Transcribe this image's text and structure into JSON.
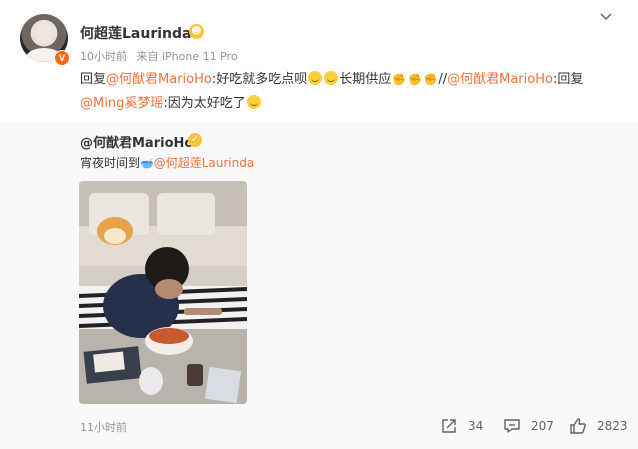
{
  "post": {
    "username": "何超莲Laurinda",
    "time": "10小时前",
    "source": "来自 iPhone 11 Pro",
    "text": {
      "p1": "回复",
      "mention1": "@何猷君MarioHo",
      "p2": ":好吃就多吃点呗",
      "p3": "长期供应",
      "p4": "//",
      "mention2": "@何猷君MarioHo",
      "p5": ":回复",
      "mention3": "@Ming奚梦瑶",
      "p6": ":因为太好吃了"
    }
  },
  "retweet": {
    "username": "@何猷君MarioHo",
    "text_prefix": "宵夜时间到",
    "mention": "@何超莲Laurinda",
    "time": "11小时前",
    "actions": {
      "share_count": "34",
      "comment_count": "207",
      "like_count": "2823"
    }
  },
  "icons": {
    "share": "share-icon",
    "comment": "comment-icon",
    "like": "thumbs-up-icon",
    "menu": "chevron-down-icon"
  },
  "colors": {
    "link": "#eb7340",
    "meta": "#939393",
    "retweet_bg": "#f9f9f9"
  }
}
